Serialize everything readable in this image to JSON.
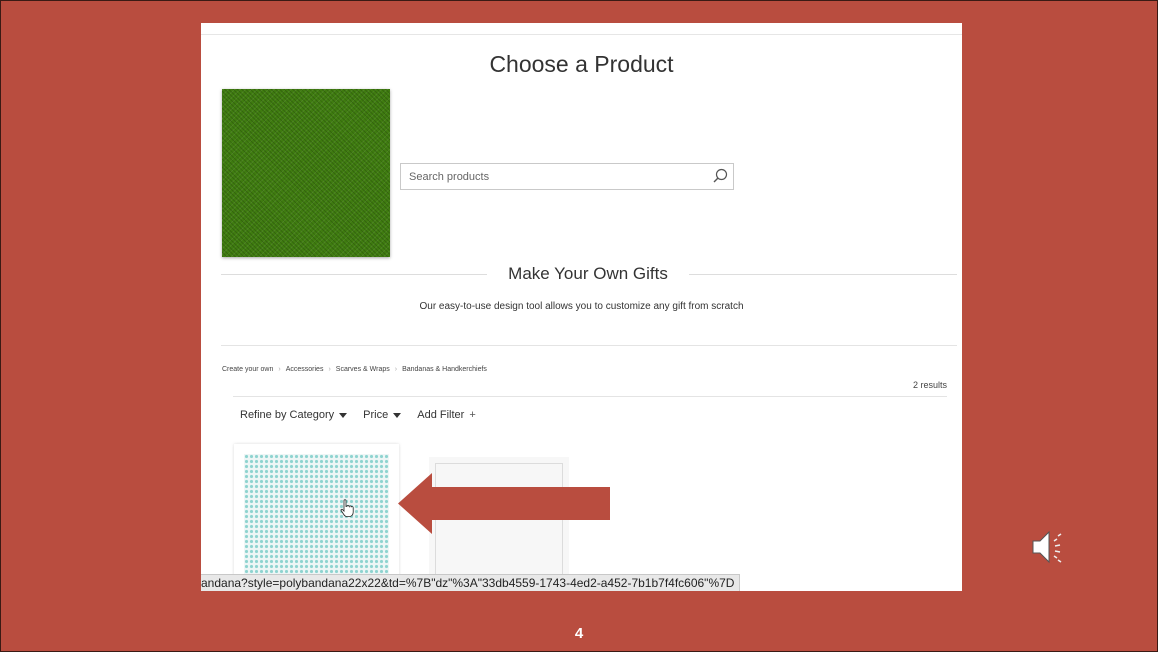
{
  "page": {
    "title": "Choose a Product",
    "search": {
      "placeholder": "Search products"
    },
    "section": {
      "title": "Make Your Own Gifts",
      "subtitle": "Our easy-to-use design tool allows you to customize any gift from scratch"
    },
    "breadcrumb": [
      "Create your own",
      "Accessories",
      "Scarves & Wraps",
      "Bandanas & Handkerchiefs"
    ],
    "results": "2 results",
    "filters": [
      {
        "label": "Refine by Category",
        "icon": "caret-down-icon"
      },
      {
        "label": "Price",
        "icon": "caret-down-icon"
      },
      {
        "label": "Add Filter",
        "icon": "plus-icon",
        "glyph": "+"
      }
    ],
    "status_url": "andana?style=polybandana22x22&td=%7B\"dz\"%3A\"33db4559-1743-4ed2-a452-7b1b7f4fc606\"%7D"
  },
  "slide": {
    "number": "4",
    "background_color": "#b94d3f",
    "arrow_color": "#b94d3f",
    "swatch_color": "#3f7c10"
  }
}
